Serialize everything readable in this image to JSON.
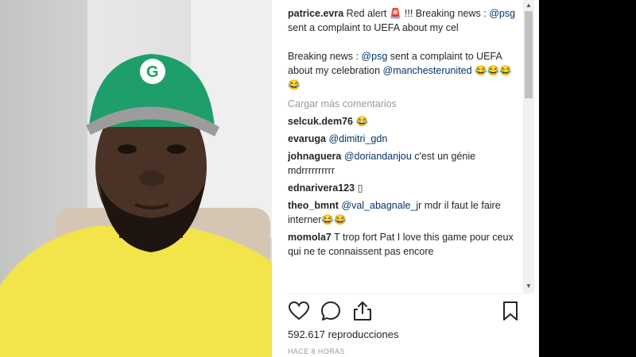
{
  "post": {
    "caption_user": "patrice.evra",
    "caption_1_pre": " Red alert 🚨 !!! Breaking news : ",
    "caption_1_mention": "@psg",
    "caption_1_post": " sent a complaint to UEFA about my cel",
    "caption_2_pre": "Breaking news : ",
    "caption_2_mention1": "@psg",
    "caption_2_mid": " sent a complaint to UEFA about my celebration ",
    "caption_2_mention2": "@manchesterunited",
    "caption_2_post": " 😂😂😂😂",
    "load_more": "Cargar más comentarios"
  },
  "comments": [
    {
      "user": "selcuk.dem76",
      "pre": " 😂",
      "mention": "",
      "post": ""
    },
    {
      "user": "evaruga",
      "pre": " ",
      "mention": "@dimitri_gdn",
      "post": ""
    },
    {
      "user": "johnaguera",
      "pre": " ",
      "mention": "@doriandanjou",
      "post": " c'est un génie mdrrrrrrrrrr"
    },
    {
      "user": "ednarivera123",
      "pre": " ▯",
      "mention": "",
      "post": ""
    },
    {
      "user": "theo_bmnt",
      "pre": " ",
      "mention": "@val_abagnale_jr",
      "post": " mdr il faut le faire interner😂😂"
    },
    {
      "user": "momola7",
      "pre": " T trop fort Pat I love this game pour ceux qui ne te connaissent pas encore",
      "mention": "",
      "post": ""
    }
  ],
  "stats": {
    "views": "592.617 reproducciones",
    "time": "HACE 8 HORAS"
  },
  "icons": {
    "like": "heart-icon",
    "comment": "comment-bubble-icon",
    "share": "share-icon",
    "save": "bookmark-icon"
  },
  "colors": {
    "link": "#003569",
    "muted": "#999999",
    "cap_green": "#1e9e6a",
    "shirt_yellow": "#f2e44a"
  }
}
